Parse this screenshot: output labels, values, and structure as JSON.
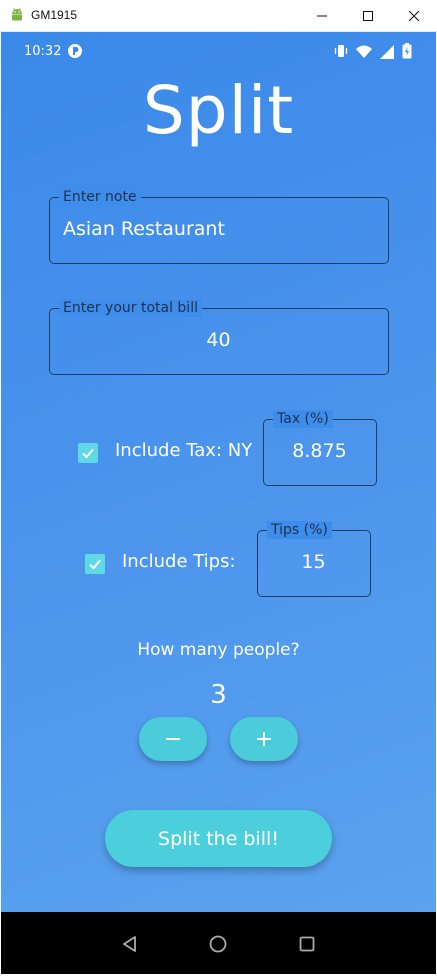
{
  "window": {
    "title": "GM1915",
    "icons": {
      "app": "android-icon",
      "minimize": "minimize-icon",
      "maximize": "maximize-icon",
      "close": "close-icon"
    }
  },
  "statusbar": {
    "time": "10:32",
    "icons": [
      "notification-icon",
      "vibrate-icon",
      "wifi-icon",
      "signal-icon",
      "battery-icon"
    ]
  },
  "app": {
    "title": "Split",
    "note": {
      "label": "Enter note",
      "value": "Asian Restaurant"
    },
    "bill": {
      "label": "Enter your total bill",
      "value": "40"
    },
    "tax": {
      "checkbox_label": "Include Tax: NY",
      "checked": true,
      "field_label": "Tax (%)",
      "value": "8.875"
    },
    "tips": {
      "checkbox_label": "Include Tips:",
      "checked": true,
      "field_label": "Tips (%)",
      "value": "15"
    },
    "people": {
      "question": "How many people?",
      "count": "3",
      "decrement_icon": "minus-icon",
      "increment_icon": "plus-icon"
    },
    "split_button": "Split the bill!"
  },
  "navbar": {
    "icons": [
      "back-icon",
      "home-icon",
      "recents-icon"
    ]
  },
  "colors": {
    "accent": "#4ccfdc",
    "checkbox": "#5fd9e3",
    "outline": "#1d3d68",
    "background_top": "#3a89ea",
    "background_bottom": "#5ba2ef"
  }
}
